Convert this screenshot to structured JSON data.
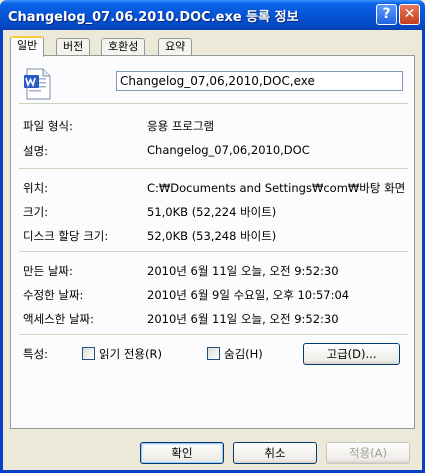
{
  "window": {
    "title": "Changelog_07.06.2010.DOC.exe 등록 정보",
    "help_glyph": "?",
    "close_glyph": "✕"
  },
  "tabs": [
    {
      "label": "일반",
      "active": true
    },
    {
      "label": "버전",
      "active": false
    },
    {
      "label": "호환성",
      "active": false
    },
    {
      "label": "요약",
      "active": false
    }
  ],
  "general": {
    "filename": "Changelog_07,06,2010,DOC,exe",
    "file_type_label": "파일 형식:",
    "file_type_value": "응용 프로그램",
    "description_label": "설명:",
    "description_value": "Changelog_07,06,2010,DOC",
    "location_label": "위치:",
    "location_value": "C:₩Documents and Settings₩com₩바탕 화면",
    "size_label": "크기:",
    "size_value": "51,0KB (52,224 바이트)",
    "size_on_disk_label": "디스크 할당 크기:",
    "size_on_disk_value": "52,0KB (53,248 바이트)",
    "created_label": "만든 날짜:",
    "created_value": "2010년 6월 11일 오늘, 오전 9:52:30",
    "modified_label": "수정한 날짜:",
    "modified_value": "2010년 6월 9일 수요일, 오후 10:57:04",
    "accessed_label": "액세스한 날짜:",
    "accessed_value": "2010년 6월 11일 오늘, 오전 9:52:30",
    "attributes_label": "특성:",
    "readonly_label": "읽기 전용(R)",
    "hidden_label": "숨김(H)",
    "advanced_label": "고급(D)..."
  },
  "footer": {
    "ok_label": "확인",
    "cancel_label": "취소",
    "apply_label": "적용(A)"
  },
  "colors": {
    "titlebar": "#0553d6",
    "dialog_bg": "#ece9d8",
    "active_tab_accent": "#ffc83c"
  }
}
